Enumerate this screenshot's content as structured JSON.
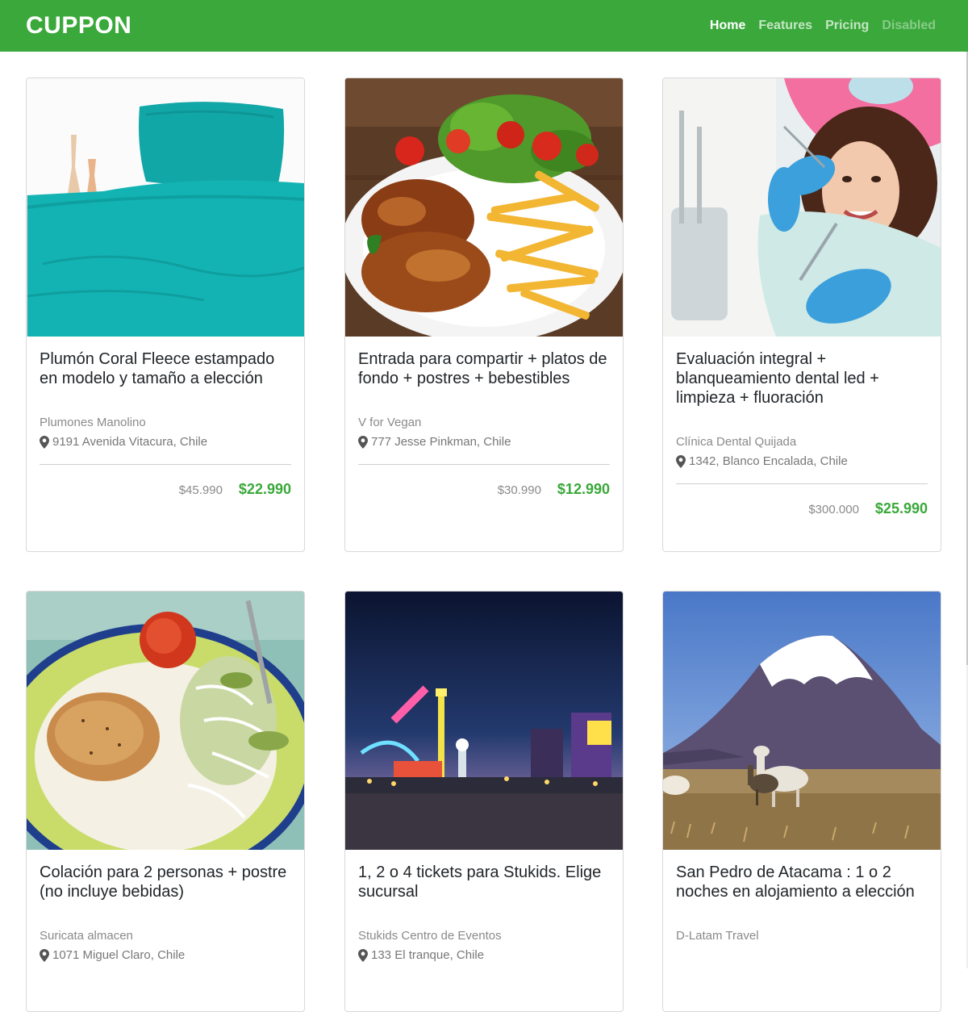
{
  "navbar": {
    "brand": "CUPPON",
    "links": [
      {
        "label": "Home",
        "state": "active"
      },
      {
        "label": "Features",
        "state": "normal"
      },
      {
        "label": "Pricing",
        "state": "normal"
      },
      {
        "label": "Disabled",
        "state": "disabled"
      }
    ]
  },
  "colors": {
    "brand": "#3aa83a",
    "price": "#3aa83a"
  },
  "deals": [
    {
      "title": "Plumón Coral Fleece estampado en modelo y tamaño a elección",
      "merchant": "Plumones Manolino",
      "address": "9191 Avenida Vitacura, Chile",
      "old_price": "$45.990",
      "new_price": "$22.990",
      "image": "teal-bedding-photo"
    },
    {
      "title": "Entrada para compartir + platos de fondo + postres + bebestibles",
      "merchant": "V for Vegan",
      "address": "777 Jesse Pinkman, Chile",
      "old_price": "$30.990",
      "new_price": "$12.990",
      "image": "chicken-fries-salad-photo"
    },
    {
      "title": "Evaluación integral + blanqueamiento dental led + limpieza + fluoración",
      "merchant": "Clínica Dental Quijada",
      "address": "1342, Blanco Encalada, Chile",
      "old_price": "$300.000",
      "new_price": "$25.990",
      "image": "dentist-patient-photo"
    },
    {
      "title": "Colación para 2 personas + postre (no incluye bebidas)",
      "merchant": "Suricata almacen",
      "address": "1071 Miguel Claro, Chile",
      "image": "grilled-chicken-plate-photo"
    },
    {
      "title": "1, 2 o 4 tickets para Stukids. Elige sucursal",
      "merchant": "Stukids Centro de Eventos",
      "address": "133 El tranque, Chile",
      "image": "amusement-park-night-photo"
    },
    {
      "title": "San Pedro de Atacama : 1 o 2 noches en alojamiento a elección",
      "merchant": "D-Latam Travel",
      "image": "volcano-llamas-photo"
    }
  ]
}
